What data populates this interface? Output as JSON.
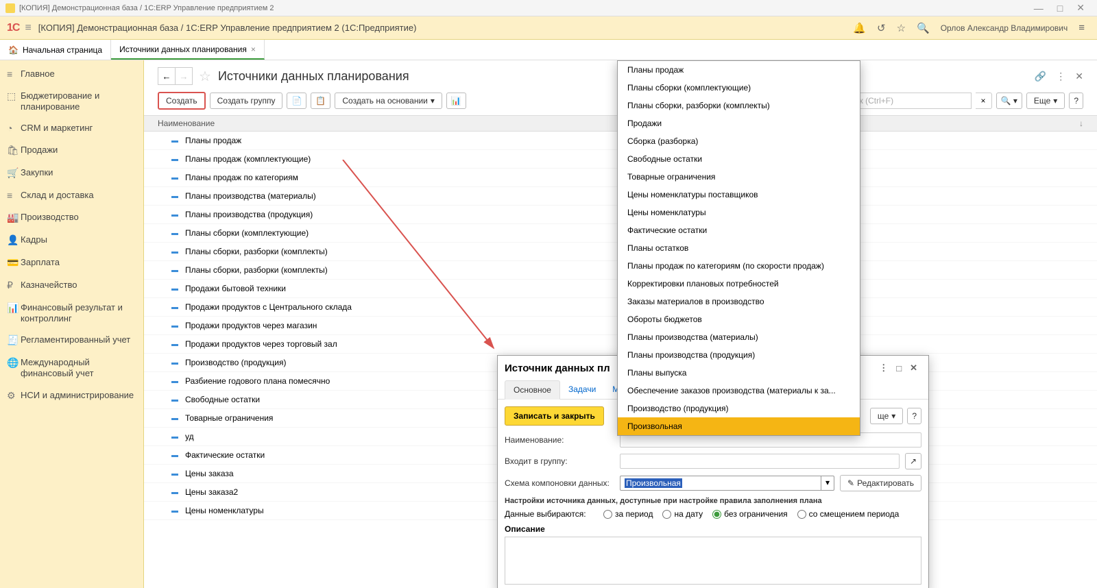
{
  "titlebar": {
    "text": "[КОПИЯ] Демонстрационная база / 1С:ERP Управление предприятием 2"
  },
  "header": {
    "logo": "1С",
    "title": "[КОПИЯ] Демонстрационная база / 1С:ERP Управление предприятием 2  (1С:Предприятие)",
    "user": "Орлов Александр Владимирович"
  },
  "tabs": {
    "home": "Начальная страница",
    "active": "Источники данных планирования"
  },
  "sidebar": [
    {
      "icon": "≡",
      "label": "Главное"
    },
    {
      "icon": "⬚",
      "label": "Бюджетирование и планирование"
    },
    {
      "icon": "◔",
      "label": "CRM и маркетинг"
    },
    {
      "icon": "🛍",
      "label": "Продажи"
    },
    {
      "icon": "🛒",
      "label": "Закупки"
    },
    {
      "icon": "≡",
      "label": "Склад и доставка"
    },
    {
      "icon": "🏭",
      "label": "Производство"
    },
    {
      "icon": "👤",
      "label": "Кадры"
    },
    {
      "icon": "💳",
      "label": "Зарплата"
    },
    {
      "icon": "₽",
      "label": "Казначейство"
    },
    {
      "icon": "📊",
      "label": "Финансовый результат и контроллинг"
    },
    {
      "icon": "🧾",
      "label": "Регламентированный учет"
    },
    {
      "icon": "🌐",
      "label": "Международный финансовый учет"
    },
    {
      "icon": "⚙",
      "label": "НСИ и администрирование"
    }
  ],
  "content": {
    "title": "Источники данных планирования",
    "toolbar": {
      "create": "Создать",
      "create_group": "Создать группу",
      "create_based": "Создать на основании",
      "more": "Еще",
      "search_placeholder": "Поиск (Ctrl+F)"
    },
    "table": {
      "header": "Наименование",
      "rows": [
        "Планы продаж",
        "Планы продаж (комплектующие)",
        "Планы продаж по категориям",
        "Планы производства (материалы)",
        "Планы производства (продукция)",
        "Планы сборки (комплектующие)",
        "Планы сборки, разборки (комплекты)",
        "Планы сборки, разборки (комплекты)",
        "Продажи бытовой техники",
        "Продажи продуктов с Центрального склада",
        "Продажи продуктов через магазин",
        "Продажи продуктов через торговый зал",
        "Производство (продукция)",
        "Разбиение годового плана помесячно",
        "Свободные остатки",
        "Товарные ограничения",
        "уд",
        "Фактические остатки",
        "Цены заказа",
        "Цены заказа2",
        "Цены номенклатуры"
      ]
    }
  },
  "dialog": {
    "title": "Источник данных пл",
    "tabs": {
      "main": "Основное",
      "tasks": "Задачи",
      "t3": "Мо"
    },
    "save_close": "Записать и закрыть",
    "more": "ще",
    "help": "?",
    "name_label": "Наименование:",
    "group_label": "Входит в группу:",
    "scheme_label": "Схема компоновки данных:",
    "scheme_value": "Произвольная",
    "edit": "Редактировать",
    "section": "Настройки источника данных, доступные при настройке правила заполнения плана",
    "radio_label": "Данные выбираются:",
    "radios": [
      "за период",
      "на дату",
      "без ограничения",
      "со смещением периода"
    ],
    "desc_label": "Описание"
  },
  "dropdown": [
    "Планы продаж",
    "Планы сборки (комплектующие)",
    "Планы сборки, разборки (комплекты)",
    "Продажи",
    "Сборка (разборка)",
    "Свободные остатки",
    "Товарные ограничения",
    "Цены номенклатуры поставщиков",
    "Цены номенклатуры",
    "Фактические остатки",
    "Планы остатков",
    "Планы продаж по категориям (по скорости продаж)",
    "Корректировки плановых потребностей",
    "Заказы материалов в производство",
    "Обороты бюджетов",
    "Планы производства (материалы)",
    "Планы производства (продукция)",
    "Планы выпуска",
    "Обеспечение заказов производства (материалы к за...",
    "Производство (продукция)",
    "Произвольная"
  ]
}
